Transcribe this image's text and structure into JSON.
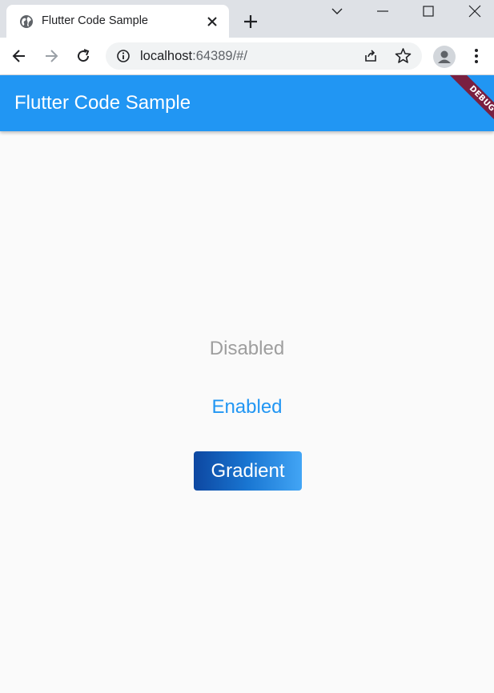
{
  "browser": {
    "tab": {
      "title": "Flutter Code Sample"
    },
    "address_bar": {
      "host": "localhost",
      "path": ":64389/#/"
    }
  },
  "app": {
    "title": "Flutter Code Sample",
    "debug_banner": "DEBUG",
    "accent_color": "#2196f3",
    "buttons": {
      "disabled": "Disabled",
      "enabled": "Enabled",
      "gradient": "Gradient"
    },
    "gradient_colors": [
      "#0d47a1",
      "#1976d2",
      "#42a5f5"
    ]
  }
}
